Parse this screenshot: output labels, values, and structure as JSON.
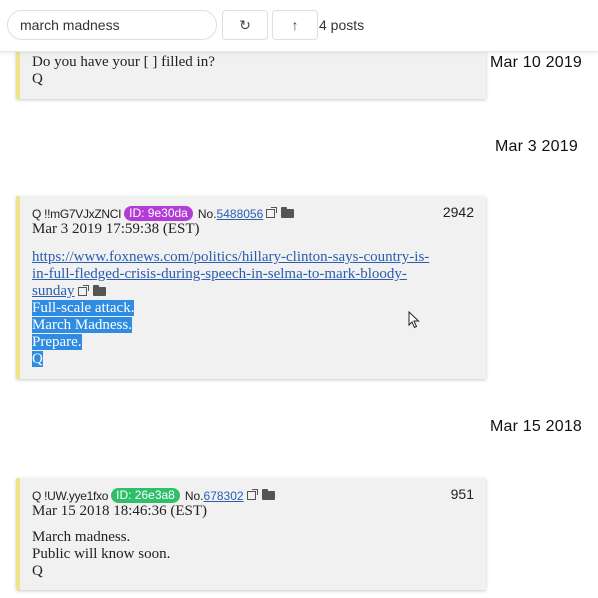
{
  "search": {
    "value": "march madness"
  },
  "toolbar": {
    "refresh_icon": "↻",
    "up_icon": "↑",
    "count": "4 posts"
  },
  "dates": [
    "Mar 10 2019",
    "Mar 3 2019",
    "Mar 15 2018"
  ],
  "posts": [
    {
      "lines": [
        "Do you have your [        ] filled in?",
        "Q"
      ]
    },
    {
      "author": "Q !!mG7VJxZNCI",
      "id_label": "ID: 9e30da",
      "id_color": "#b43cd6",
      "no_prefix": "No.",
      "no_link": "5488056",
      "number": "2942",
      "timestamp": "Mar 3 2019 17:59:38 (EST)",
      "link_lines": [
        "https://www.foxnews.com/politics/hillary-clinton-says-country-is-",
        "in-full-fledged-crisis-during-speech-in-selma-to-mark-bloody-",
        "sunday"
      ],
      "lines": [
        "Full-scale attack.",
        "March Madness.",
        "Prepare.",
        "Q"
      ]
    },
    {
      "author": "Q !UW.yye1fxo",
      "id_label": "ID: 26e3a8",
      "id_color": "#2fbf6a",
      "no_prefix": "No.",
      "no_link": "678302",
      "number": "951",
      "timestamp": "Mar 15 2018 18:46:36 (EST)",
      "lines": [
        "March madness.",
        "Public will know soon.",
        "Q"
      ]
    }
  ]
}
